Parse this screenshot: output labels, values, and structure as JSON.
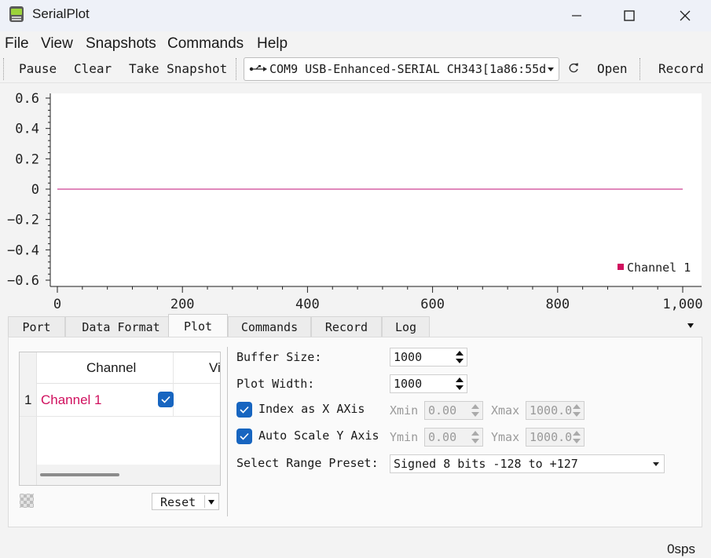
{
  "window": {
    "title": "SerialPlot",
    "minimize_icon": "minimize-icon",
    "maximize_icon": "maximize-icon",
    "close_icon": "close-icon"
  },
  "menu": {
    "items": [
      "File",
      "View",
      "Snapshots",
      "Commands",
      "Help"
    ]
  },
  "toolbar": {
    "pause": "Pause",
    "clear": "Clear",
    "take_snapshot": "Take Snapshot",
    "port": "COM9 USB-Enhanced-SERIAL CH343[1a86:55d",
    "refresh_icon": "refresh-icon",
    "open": "Open",
    "record": "Record"
  },
  "chart_data": {
    "type": "line",
    "title": "",
    "xlabel": "",
    "ylabel": "",
    "xlim": [
      0,
      1000
    ],
    "ylim": [
      -0.6,
      0.6
    ],
    "x_ticks": [
      "0",
      "200",
      "400",
      "600",
      "800",
      "1,000"
    ],
    "y_ticks": [
      "0.6",
      "0.4",
      "0.2",
      "0",
      "−0.2",
      "−0.4",
      "−0.6"
    ],
    "series": [
      {
        "name": "Channel 1",
        "color": "#c0127a",
        "x": [
          0,
          1000
        ],
        "y": [
          0,
          0
        ]
      }
    ],
    "legend_position": "bottom-right",
    "grid": false
  },
  "tabs": [
    "Port",
    "Data Format",
    "Plot",
    "Commands",
    "Record",
    "Log"
  ],
  "active_tab": "Plot",
  "channel_table": {
    "headers": [
      "Channel",
      "Visib"
    ],
    "rows": [
      {
        "index": "1",
        "name": "Channel 1",
        "visible": true,
        "color": "#d0105e"
      }
    ],
    "reset_label": "Reset"
  },
  "plot_settings": {
    "buffer_size_label": "Buffer Size:",
    "buffer_size": "1000",
    "plot_width_label": "Plot Width:",
    "plot_width": "1000",
    "index_as_x_label": "Index as X AXis",
    "index_as_x_checked": true,
    "xmin_label": "Xmin",
    "xmin": "0.00",
    "xmax_label": "Xmax",
    "xmax": "1000.0",
    "auto_scale_label": "Auto Scale Y Axis",
    "auto_scale_checked": true,
    "ymin_label": "Ymin",
    "ymin": "0.00",
    "ymax_label": "Ymax",
    "ymax": "1000.0",
    "range_preset_label": "Select Range Preset:",
    "range_preset": "Signed 8 bits -128 to +127"
  },
  "status": {
    "rate": "0sps"
  }
}
